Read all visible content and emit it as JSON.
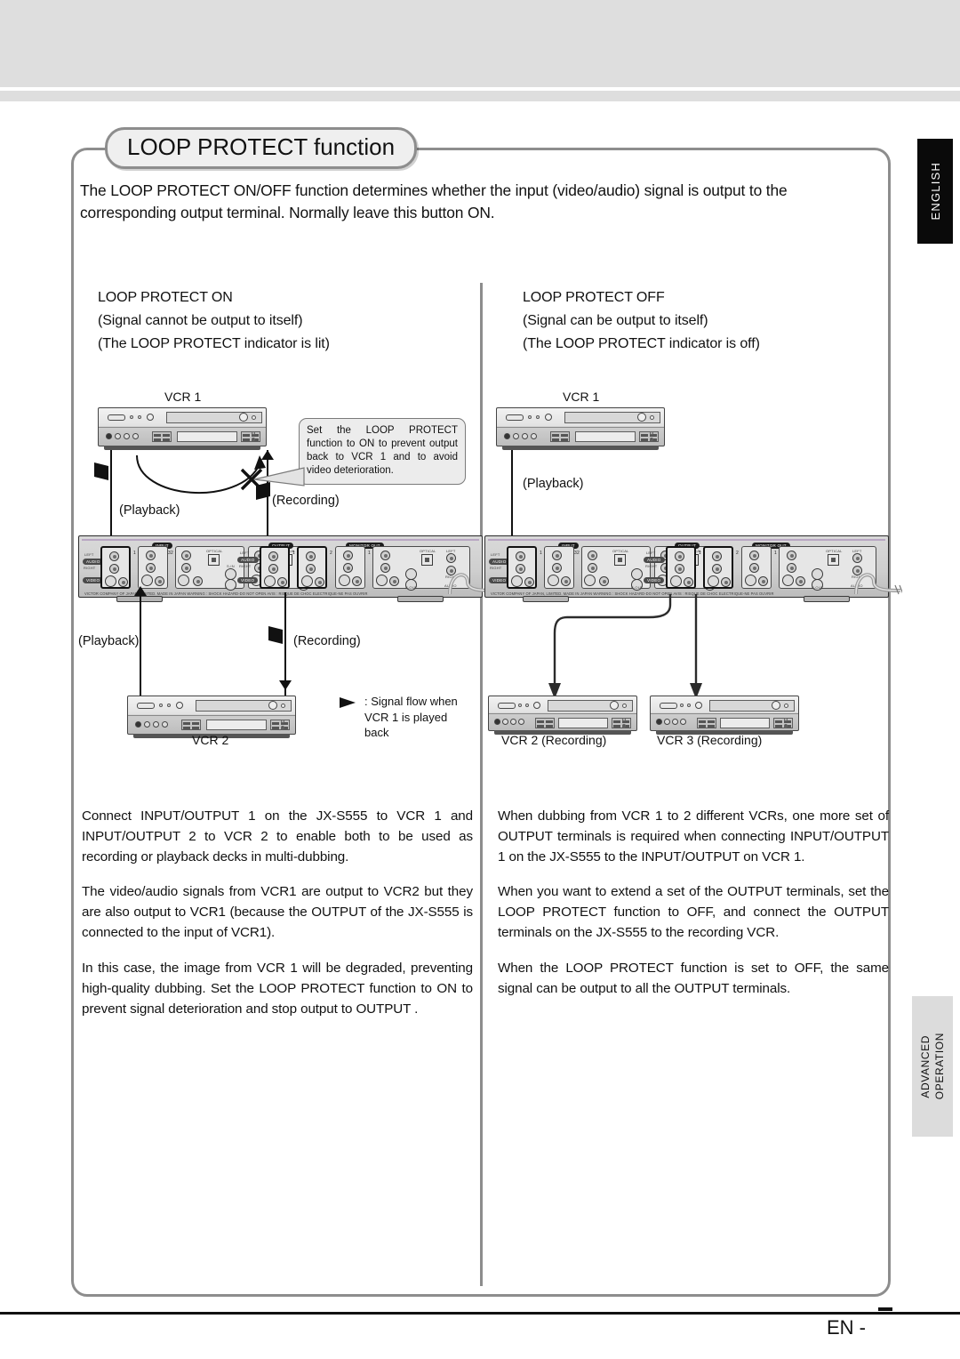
{
  "page": {
    "language_tab": "ENGLISH",
    "section_tab_line1": "ADVANCED",
    "section_tab_line2": "OPERATION",
    "footer_page": "EN -"
  },
  "frame": {
    "title": "LOOP PROTECT function",
    "intro": "The LOOP PROTECT ON/OFF function determines whether the input (video/audio) signal is output to the corresponding output terminal. Normally leave this button ON."
  },
  "columns": {
    "left": {
      "heading": "LOOP PROTECT ON",
      "sub1": "(Signal cannot be output to itself)",
      "sub2": "(The LOOP PROTECT indicator is lit)",
      "diagram": {
        "vcr1_label": "VCR 1",
        "vcr2_label": "VCR 2",
        "playback_top": "(Playback)",
        "recording_top": "(Recording)",
        "playback_bottom": "(Playback)",
        "recording_bottom": "(Recording)",
        "callout": "Set the LOOP PROTECT function to ON to prevent output back to  VCR 1 and to avoid video deterioration.",
        "legend": ": Signal flow when VCR 1 is played back"
      },
      "paragraphs": [
        "Connect INPUT/OUTPUT 1 on the JX-S555 to VCR 1 and INPUT/OUTPUT 2 to VCR 2 to enable both to be used as recording or playback decks in multi-dubbing.",
        "The video/audio signals from VCR1 are output to VCR2 but they are also output to VCR1 (because the OUTPUT      of the JX-S555 is connected to the input of VCR1).",
        "In this case, the image from VCR 1 will be degraded, preventing high-quality dubbing.  Set the LOOP PROTECT function to ON to prevent signal deterioration and stop output to OUTPUT    ."
      ]
    },
    "right": {
      "heading": "LOOP PROTECT OFF",
      "sub1": "(Signal can be output to itself)",
      "sub2": "(The LOOP PROTECT indicator is off)",
      "diagram": {
        "vcr1_label": "VCR 1",
        "playback": "(Playback)",
        "vcr2_label": "VCR 2 (Recording)",
        "vcr3_label": "VCR 3 (Recording)"
      },
      "paragraphs": [
        "When dubbing from VCR 1 to 2 different VCRs, one more set of OUTPUT terminals is required when connecting INPUT/OUTPUT 1 on the JX-S555 to the INPUT/OUTPUT on VCR 1.",
        "When you want to extend a set of the OUTPUT terminals, set the LOOP PROTECT function to OFF, and connect the OUTPUT      terminals on the JX-S555 to the recording VCR.",
        "When the LOOP PROTECT function is set to OFF, the same signal can be output to all the OUTPUT terminals."
      ]
    }
  },
  "panel": {
    "caption_input": "INPUT",
    "caption_output": "OUTPUT",
    "caption_monitor": "MONITOR OUT",
    "label_left": "LEFT",
    "label_right": "RIGHT",
    "label_audio": "AUDIO",
    "label_video": "VIDEO",
    "label_optical": "OPTICAL",
    "label_sin": "S-IN",
    "label_sout": "S-OUT",
    "legal": "VICTOR COMPANY OF JAPAN, LIMITED.  MADE IN JAPAN          WARNING : SHOCK HAZARD-DO NOT OPEN          AVIS : RISQUE DE CHOC ELECTRIQUE-NE PAS OUVRIR",
    "numbers": [
      "1",
      "2",
      "3",
      "4",
      "5"
    ]
  },
  "colors": {
    "frame_border": "#8d8d8d",
    "tab_english_bg": "#0a0a0a",
    "tab_advanced_bg": "#dcdcdc",
    "panel_body": "#cfcfcf",
    "ink": "#111111"
  }
}
